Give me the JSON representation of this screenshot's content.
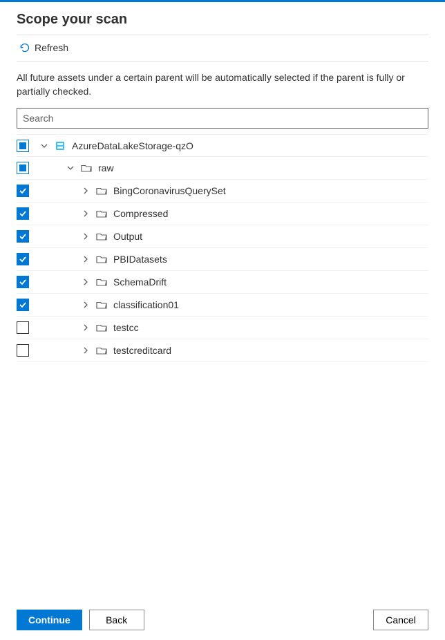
{
  "title": "Scope your scan",
  "refresh_label": "Refresh",
  "description": "All future assets under a certain parent will be automatically selected if the parent is fully or partially checked.",
  "search_placeholder": "Search",
  "tree": {
    "root": {
      "label": "AzureDataLakeStorage-qzO",
      "state": "partial",
      "expanded": true,
      "icon": "storage"
    },
    "raw": {
      "label": "raw",
      "state": "partial",
      "expanded": true,
      "icon": "folder"
    },
    "children": [
      {
        "label": "BingCoronavirusQuerySet",
        "state": "checked"
      },
      {
        "label": "Compressed",
        "state": "checked"
      },
      {
        "label": "Output",
        "state": "checked"
      },
      {
        "label": "PBIDatasets",
        "state": "checked"
      },
      {
        "label": "SchemaDrift",
        "state": "checked"
      },
      {
        "label": "classification01",
        "state": "checked"
      },
      {
        "label": "testcc",
        "state": "unchecked"
      },
      {
        "label": "testcreditcard",
        "state": "unchecked"
      }
    ]
  },
  "buttons": {
    "continue": "Continue",
    "back": "Back",
    "cancel": "Cancel"
  }
}
